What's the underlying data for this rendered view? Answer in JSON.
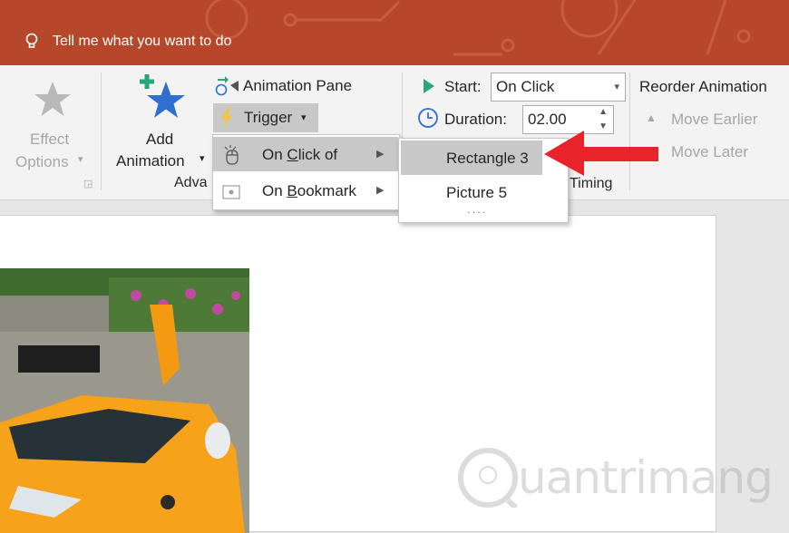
{
  "title_bar": {
    "tell_me": "Tell me what you want to do"
  },
  "ribbon": {
    "effect_options": {
      "line1": "Effect",
      "line2": "Options"
    },
    "add_animation": {
      "line1": "Add",
      "line2": "Animation"
    },
    "animation_pane": "Animation Pane",
    "trigger": "Trigger",
    "advanced_group_label_partial": "Adva",
    "start": {
      "label": "Start:",
      "value": "On Click"
    },
    "duration": {
      "label": "Duration:",
      "value": "02.00"
    },
    "timing_group_label": "Timing",
    "reorder_animation": "Reorder Animation",
    "move_earlier": "Move Earlier",
    "move_later": "Move Later"
  },
  "trigger_menu": {
    "items": [
      {
        "label": "On Click of",
        "underline_char": "C"
      },
      {
        "label": "On Bookmark",
        "underline_char": "B"
      }
    ]
  },
  "submenu": {
    "items": [
      "Rectangle 3",
      "Picture 5"
    ],
    "more": "...."
  },
  "colors": {
    "title_bar": "#b7472a",
    "ribbon": "#f3f3f3",
    "highlight": "#c8c8c8",
    "arrow": "#e8232a",
    "star": "#2f6fd0",
    "car": "#f6a21a"
  },
  "watermark": "uantrimang"
}
